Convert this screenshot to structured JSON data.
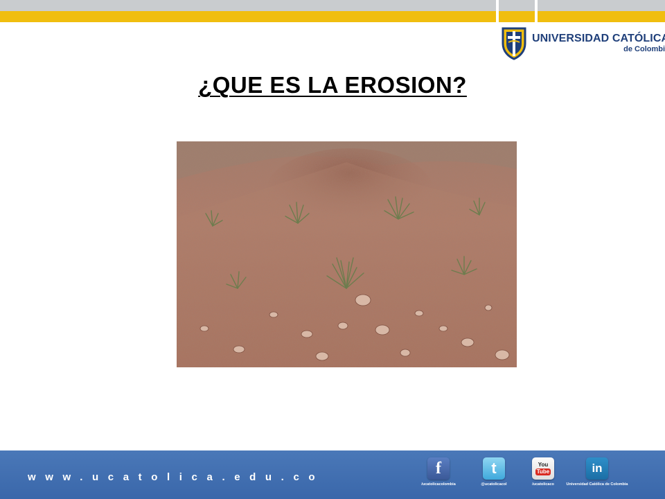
{
  "header": {
    "logo": {
      "name_part1": "UNIVERSIDAD",
      "name_part2": "CATÓLICA",
      "subtitle": "de Colombia"
    }
  },
  "slide": {
    "title": "¿QUE ES LA EROSION?"
  },
  "footer": {
    "url": "www.ucatolica.edu.co",
    "social": [
      {
        "icon": "facebook-icon",
        "glyph": "f",
        "caption": "/ucatolicacolombia"
      },
      {
        "icon": "twitter-icon",
        "glyph": "t",
        "caption": "@ucatolicacol"
      },
      {
        "icon": "youtube-icon",
        "glyph_top": "You",
        "glyph_bottom": "Tube",
        "caption": "/ucatolicaco"
      },
      {
        "icon": "linkedin-icon",
        "glyph": "in",
        "caption": "Universidad Católica de Colombia"
      }
    ]
  },
  "colors": {
    "top_band_grey": "#c9cccf",
    "top_band_yellow": "#f0be0f",
    "footer_blue": "#3f6eb0",
    "logo_navy": "#1f3f7a"
  }
}
